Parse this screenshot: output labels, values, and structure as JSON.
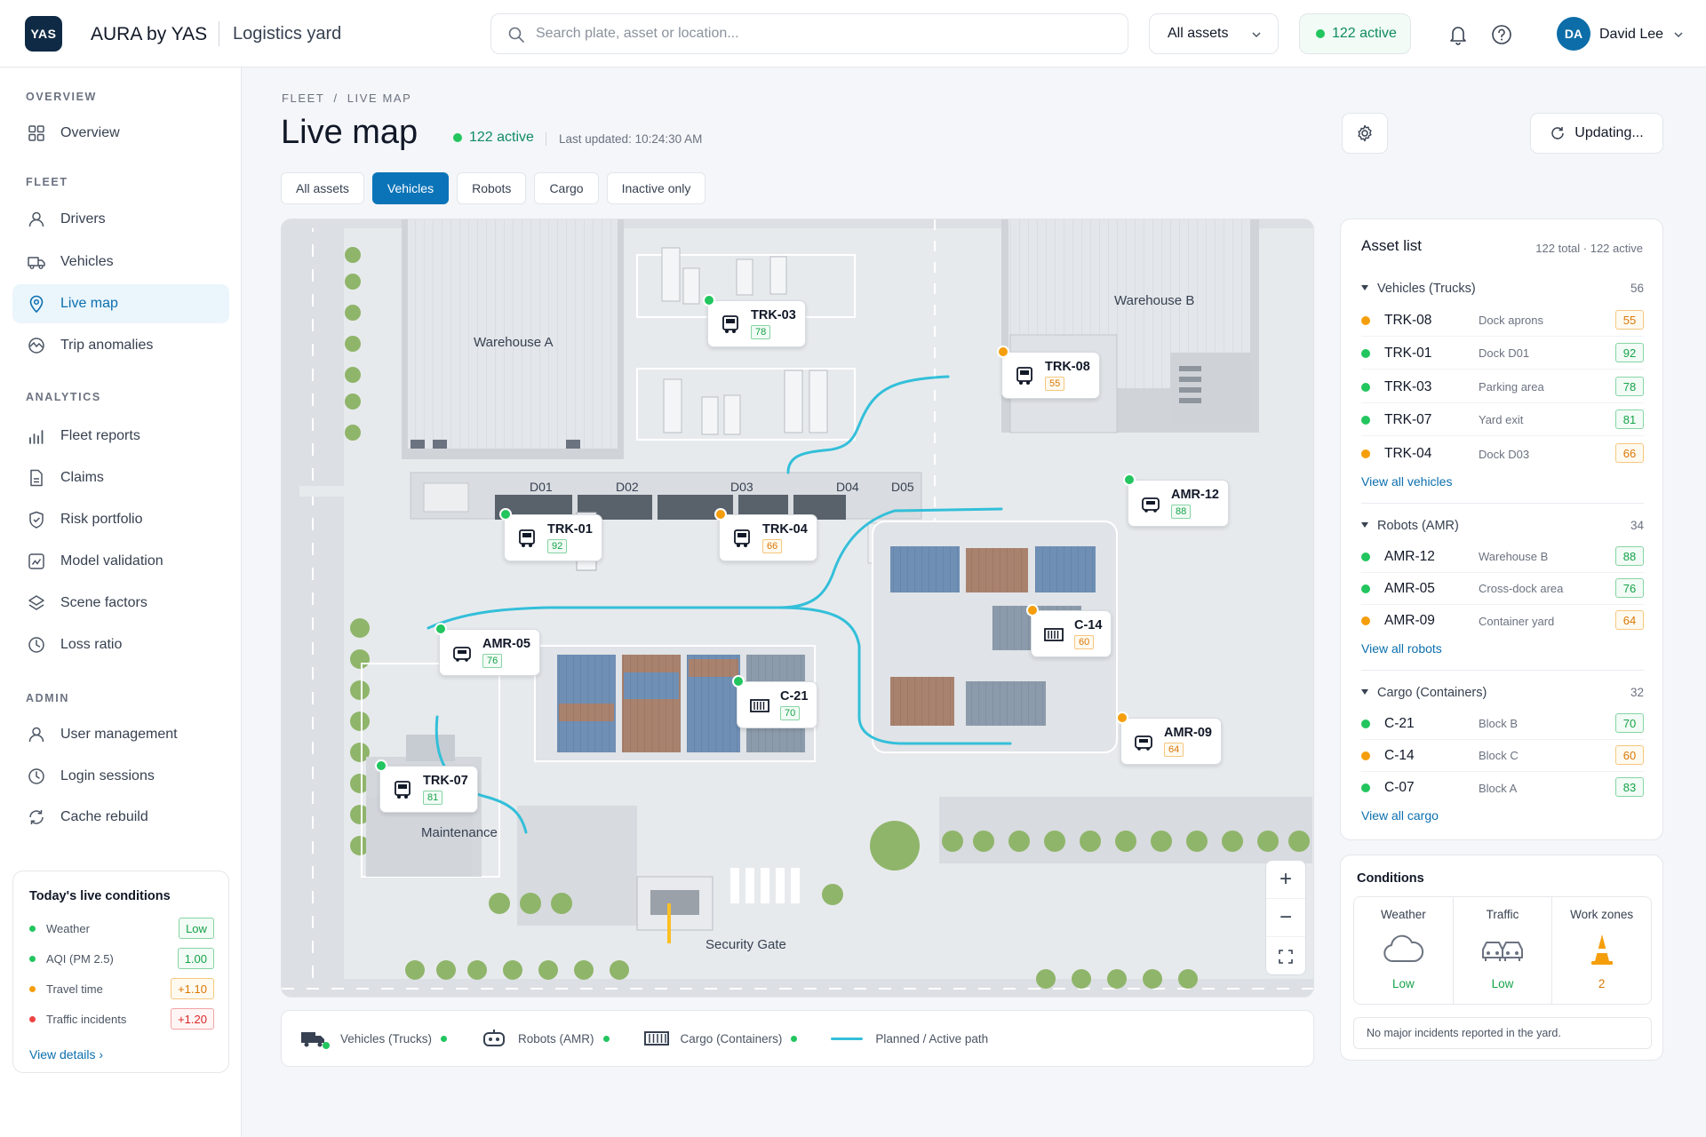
{
  "app": {
    "logo_text": "YAS",
    "title": "AURA by YAS",
    "section": "Logistics yard",
    "brand_color": "#0f2a44",
    "accent_color": "#0b74b8"
  },
  "search": {
    "placeholder": "Search plate, asset or location..."
  },
  "filters": {
    "assets_dropdown": "All assets",
    "active_pill": "122 active"
  },
  "user": {
    "initials": "DA",
    "name": "David Lee"
  },
  "sidebar": {
    "sections": [
      {
        "label": "OVERVIEW",
        "items": [
          {
            "label": "Overview",
            "icon": "grid-icon"
          }
        ]
      },
      {
        "label": "FLEET",
        "items": [
          {
            "label": "Drivers",
            "icon": "user-icon"
          },
          {
            "label": "Vehicles",
            "icon": "truck-icon"
          },
          {
            "label": "Live map",
            "icon": "map-pin-icon",
            "active": true
          },
          {
            "label": "Trip anomalies",
            "icon": "anomaly-icon"
          }
        ]
      },
      {
        "label": "ANALYTICS",
        "items": [
          {
            "label": "Fleet reports",
            "icon": "bar-chart-icon"
          },
          {
            "label": "Claims",
            "icon": "document-icon"
          },
          {
            "label": "Risk portfolio",
            "icon": "shield-icon"
          },
          {
            "label": "Model validation",
            "icon": "model-icon"
          },
          {
            "label": "Scene factors",
            "icon": "layers-icon"
          },
          {
            "label": "Loss ratio",
            "icon": "clock-chart-icon"
          }
        ]
      },
      {
        "label": "ADMIN",
        "items": [
          {
            "label": "User management",
            "icon": "user-icon"
          },
          {
            "label": "Login sessions",
            "icon": "clock-icon"
          },
          {
            "label": "Cache rebuild",
            "icon": "refresh-icon"
          }
        ]
      }
    ],
    "live_conditions": {
      "title": "Today's live conditions",
      "rows": [
        {
          "label": "Weather",
          "value": "Low",
          "status": "green"
        },
        {
          "label": "AQI (PM 2.5)",
          "value": "1.00",
          "status": "green"
        },
        {
          "label": "Travel time",
          "value": "+1.10",
          "status": "orange"
        },
        {
          "label": "Traffic incidents",
          "value": "+1.20",
          "status": "red"
        }
      ],
      "link": "View details ›"
    }
  },
  "header": {
    "breadcrumb": [
      "FLEET",
      "LIVE MAP"
    ],
    "title": "Live map",
    "active": "122 active",
    "last_updated": "Last updated: 10:24:30 AM",
    "update_button": "Updating...",
    "tabs": [
      "All assets",
      "Vehicles",
      "Robots",
      "Cargo",
      "Inactive only"
    ],
    "selected_tab": "Vehicles"
  },
  "map": {
    "labels": {
      "warehouse_a": "Warehouse A",
      "warehouse_b": "Warehouse B",
      "maintenance": "Maintenance",
      "security_gate": "Security Gate"
    },
    "docks": [
      "D01",
      "D02",
      "D03",
      "D04",
      "D05"
    ],
    "markers": [
      {
        "id": "TRK-03",
        "score": "78",
        "kind": "truck",
        "status": "green"
      },
      {
        "id": "TRK-08",
        "score": "55",
        "kind": "truck",
        "status": "orange"
      },
      {
        "id": "TRK-01",
        "score": "92",
        "kind": "truck",
        "status": "green"
      },
      {
        "id": "TRK-04",
        "score": "66",
        "kind": "truck",
        "status": "orange"
      },
      {
        "id": "AMR-12",
        "score": "88",
        "kind": "robot",
        "status": "green"
      },
      {
        "id": "AMR-05",
        "score": "76",
        "kind": "robot",
        "status": "green"
      },
      {
        "id": "C-14",
        "score": "60",
        "kind": "cargo",
        "status": "orange"
      },
      {
        "id": "C-21",
        "score": "70",
        "kind": "cargo",
        "status": "green"
      },
      {
        "id": "AMR-09",
        "score": "64",
        "kind": "robot",
        "status": "orange"
      },
      {
        "id": "TRK-07",
        "score": "81",
        "kind": "truck",
        "status": "green"
      }
    ],
    "zoom": {
      "in": "+",
      "out": "−"
    },
    "path_color": "#33bfd9"
  },
  "legend": {
    "vehicles": "Vehicles (Trucks)",
    "robots": "Robots (AMR)",
    "cargo": "Cargo (Containers)",
    "path": "Planned / Active path"
  },
  "asset_list": {
    "title": "Asset list",
    "meta": "122 total  ·  122 active",
    "groups": [
      {
        "name": "Vehicles (Trucks)",
        "count": "56",
        "link": "View all vehicles",
        "rows": [
          {
            "id": "TRK-08",
            "loc": "Dock aprons",
            "score": "55",
            "status": "orange"
          },
          {
            "id": "TRK-01",
            "loc": "Dock D01",
            "score": "92",
            "status": "green"
          },
          {
            "id": "TRK-03",
            "loc": "Parking area",
            "score": "78",
            "status": "green"
          },
          {
            "id": "TRK-07",
            "loc": "Yard exit",
            "score": "81",
            "status": "green"
          },
          {
            "id": "TRK-04",
            "loc": "Dock D03",
            "score": "66",
            "status": "orange"
          }
        ]
      },
      {
        "name": "Robots (AMR)",
        "count": "34",
        "link": "View all robots",
        "rows": [
          {
            "id": "AMR-12",
            "loc": "Warehouse B",
            "score": "88",
            "status": "green"
          },
          {
            "id": "AMR-05",
            "loc": "Cross-dock area",
            "score": "76",
            "status": "green"
          },
          {
            "id": "AMR-09",
            "loc": "Container yard",
            "score": "64",
            "status": "orange"
          }
        ]
      },
      {
        "name": "Cargo (Containers)",
        "count": "32",
        "link": "View all cargo",
        "rows": [
          {
            "id": "C-21",
            "loc": "Block B",
            "score": "70",
            "status": "green"
          },
          {
            "id": "C-14",
            "loc": "Block C",
            "score": "60",
            "status": "orange"
          },
          {
            "id": "C-07",
            "loc": "Block A",
            "score": "83",
            "status": "green"
          }
        ]
      }
    ]
  },
  "conditions": {
    "title": "Conditions",
    "weather": {
      "label": "Weather",
      "value": "Low",
      "icon": "cloud-icon"
    },
    "traffic": {
      "label": "Traffic",
      "value": "Low",
      "icon": "cars-icon"
    },
    "work_zones": {
      "label": "Work zones",
      "value": "2",
      "icon": "traffic-cone-icon"
    },
    "note": "No major incidents reported in the yard."
  }
}
